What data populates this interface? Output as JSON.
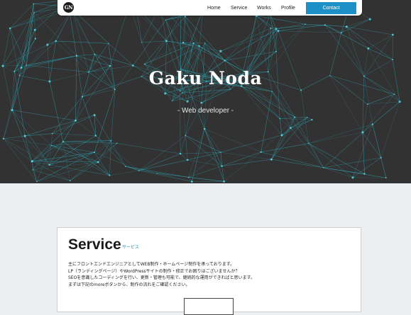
{
  "nav": {
    "logo_text": "GN",
    "links": [
      "Home",
      "Service",
      "Works",
      "Profile"
    ],
    "contact_label": "Contact"
  },
  "hero": {
    "title": "Gaku Noda",
    "subtitle": "- Web developer -"
  },
  "service": {
    "heading": "Service",
    "heading_jp": "サービス",
    "lines": [
      "主にフロントエンドエンジニアとしてWEB制作・ホームページ制作を承っております。",
      "LP（ランディングページ）やWordPressサイトの制作・修正でお困りはございませんか？",
      "SEOを意識したコーディングを行い、更新・管理も可能で、継続的な運用ができればと思います。",
      "まずは下記のmoreボタンから、制作の流れをご確認ください。"
    ]
  },
  "colors": {
    "hero_bg": "#333232",
    "accent": "#1e90c8",
    "page_bg": "#eceff2"
  }
}
